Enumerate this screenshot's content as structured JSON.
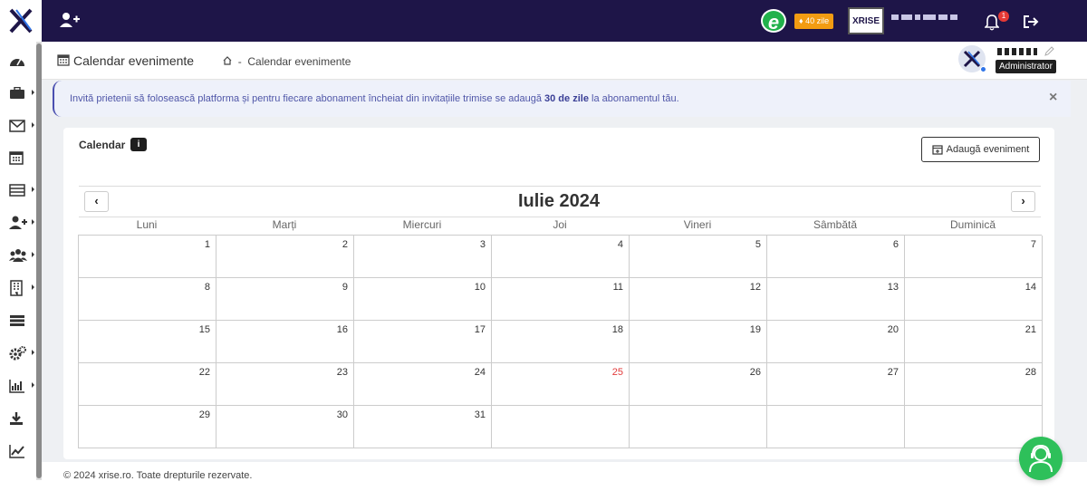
{
  "topbar": {
    "days_badge": "40 zile",
    "xrise_badge": "XRISE",
    "notification_count": "1"
  },
  "header": {
    "page_title": "Calendar evenimente",
    "breadcrumb_sep": "-",
    "breadcrumb_current": "Calendar evenimente",
    "role_tooltip": "Administrator"
  },
  "banner": {
    "text_before": "Invită prietenii să folosească platforma și pentru fiecare abonament încheiat din invitațiile trimise se adaugă ",
    "text_bold": "30 de zile",
    "text_after": " la abonamentul tău.",
    "close": "×"
  },
  "card": {
    "title": "Calendar",
    "add_event_label": "Adaugă eveniment"
  },
  "calendar": {
    "month_title": "Iulie 2024",
    "prev": "‹",
    "next": "›",
    "weekdays": [
      "Luni",
      "Marți",
      "Miercuri",
      "Joi",
      "Vineri",
      "Sâmbătă",
      "Duminică"
    ],
    "today": "25",
    "days": [
      "1",
      "2",
      "3",
      "4",
      "5",
      "6",
      "7",
      "8",
      "9",
      "10",
      "11",
      "12",
      "13",
      "14",
      "15",
      "16",
      "17",
      "18",
      "19",
      "20",
      "21",
      "22",
      "23",
      "24",
      "25",
      "26",
      "27",
      "28",
      "29",
      "30",
      "31",
      "",
      "",
      "",
      ""
    ]
  },
  "footer": {
    "text": "© 2024 xrise.ro. Toate drepturile rezervate."
  },
  "colors": {
    "topbar_bg": "#1e1548",
    "accent": "#4a4fb0",
    "today": "#e23a3a",
    "badge": "#f39c12",
    "chat": "#2ec05a"
  },
  "icons": {
    "sidebar": [
      "dashboard-icon",
      "briefcase-icon",
      "envelope-icon",
      "calendar-icon",
      "list-icon",
      "add-user-icon",
      "users-icon",
      "building-icon",
      "rows-icon",
      "cogs-icon",
      "bar-chart-icon",
      "download-icon",
      "line-chart-icon"
    ]
  }
}
